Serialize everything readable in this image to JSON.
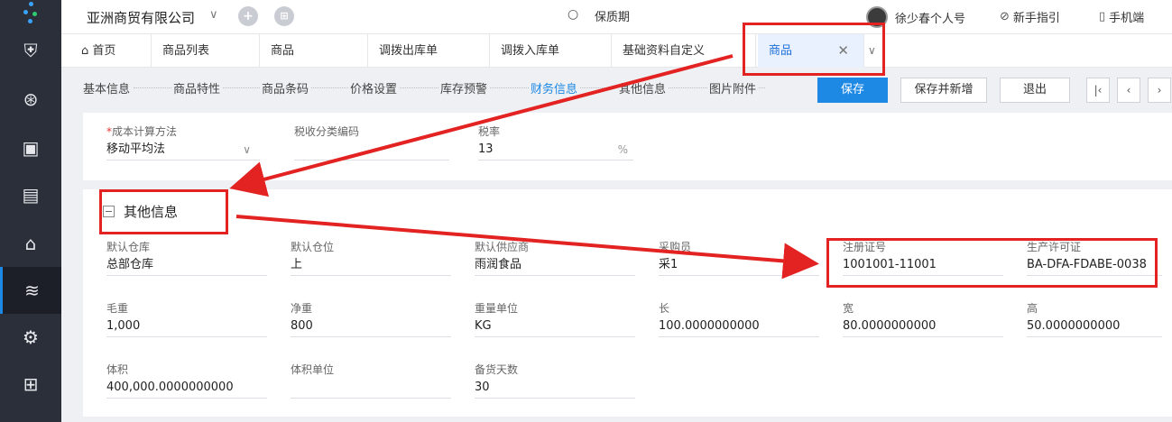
{
  "topbar": {
    "company": "亚洲商贸有限公司",
    "search_value": "保质期",
    "user_name": "徐少春个人号",
    "guide": "新手指引",
    "mobile": "手机端"
  },
  "tabs": [
    {
      "label": "首页"
    },
    {
      "label": "商品列表"
    },
    {
      "label": "商品"
    },
    {
      "label": "调拨出库单"
    },
    {
      "label": "调拨入库单"
    },
    {
      "label": "基础资料自定义"
    },
    {
      "label": "商品"
    }
  ],
  "subnav": {
    "steps": [
      "基本信息",
      "商品特性",
      "商品条码",
      "价格设置",
      "库存预警",
      "财务信息",
      "其他信息",
      "图片附件"
    ],
    "active_step": "财务信息",
    "save": "保存",
    "save_new": "保存并新增",
    "exit": "退出"
  },
  "finance": {
    "cost_method": {
      "label": "成本计算方法",
      "value": "移动平均法"
    },
    "tax_code": {
      "label": "税收分类编码",
      "value": ""
    },
    "tax_rate": {
      "label": "税率",
      "value": "13",
      "unit": "%"
    }
  },
  "other": {
    "title": "其他信息",
    "fields": [
      {
        "label": "默认仓库",
        "value": "总部仓库"
      },
      {
        "label": "默认仓位",
        "value": "上"
      },
      {
        "label": "默认供应商",
        "value": "雨润食品"
      },
      {
        "label": "采购员",
        "value": "采1"
      },
      {
        "label": "注册证号",
        "value": "1001001-11001"
      },
      {
        "label": "生产许可证",
        "value": "BA-DFA-FDABE-0038"
      },
      {
        "label": "毛重",
        "value": "1,000"
      },
      {
        "label": "净重",
        "value": "800"
      },
      {
        "label": "重量单位",
        "value": "KG"
      },
      {
        "label": "长",
        "value": "100.0000000000"
      },
      {
        "label": "宽",
        "value": "80.0000000000"
      },
      {
        "label": "高",
        "value": "50.0000000000"
      },
      {
        "label": "体积",
        "value": "400,000.0000000000"
      },
      {
        "label": "体积单位",
        "value": ""
      },
      {
        "label": "备货天数",
        "value": "30"
      }
    ]
  },
  "colors": {
    "accent": "#1e88e5",
    "annotation": "#e32222",
    "nav_bg": "#2b2f3a"
  }
}
